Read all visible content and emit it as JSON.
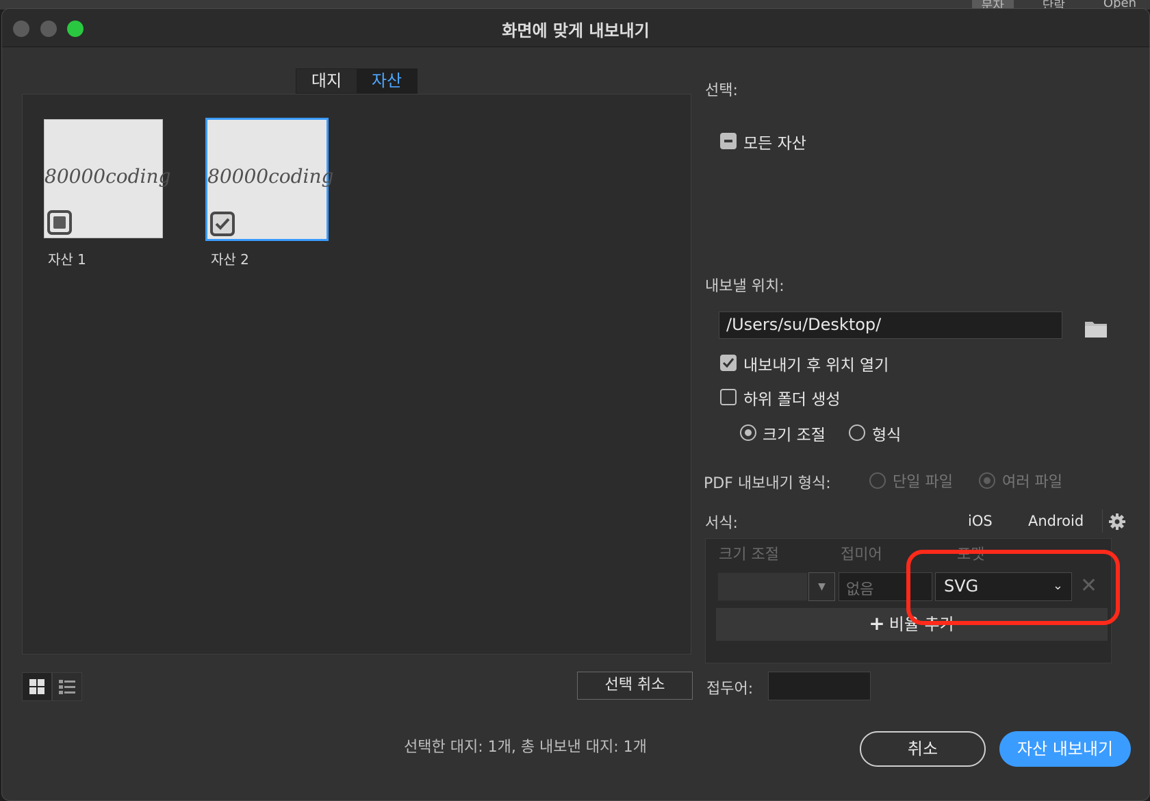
{
  "background": {
    "tabs": [
      "문자",
      "단락",
      "Open"
    ]
  },
  "window": {
    "title": "화면에 맞게 내보내기"
  },
  "left": {
    "tabs": [
      {
        "label": "대지",
        "active": false
      },
      {
        "label": "자산",
        "active": true
      }
    ],
    "assets": [
      {
        "thumb_text": "80000coding",
        "label": "자산 1",
        "checked": false
      },
      {
        "thumb_text": "80000coding",
        "label": "자산 2",
        "checked": true
      }
    ],
    "view_modes": [
      "grid-view-icon",
      "list-view-icon"
    ],
    "deselect_label": "선택 취소",
    "summary": "선택한 대지: 1개, 총 내보낸 대지: 1개"
  },
  "right": {
    "selection_label": "선택:",
    "all_assets_label": "모든 자산",
    "export_location_label": "내보낼 위치:",
    "path_value": "/Users/su/Desktop/",
    "open_after_export_label": "내보내기 후 위치 열기",
    "create_subfolder_label": "하위 폴더 생성",
    "subfolder_options": {
      "scale": "크기 조절",
      "format": "형식"
    },
    "pdf_label": "PDF 내보내기 형식:",
    "pdf_options": {
      "single": "단일 파일",
      "multiple": "여러 파일"
    },
    "format_label": "서식:",
    "platforms": [
      "iOS",
      "Android"
    ],
    "columns": {
      "scale": "크기 조절",
      "suffix": "접미어",
      "format": "포맷"
    },
    "suffix_placeholder": "없음",
    "format_value": "SVG",
    "add_scale_label": "비율 추가",
    "prefix_label": "접두어:",
    "prefix_value": ""
  },
  "footer": {
    "cancel_label": "취소",
    "export_label": "자산 내보내기"
  },
  "colors": {
    "accent": "#3b9cff",
    "highlight": "#ff2a1a"
  }
}
